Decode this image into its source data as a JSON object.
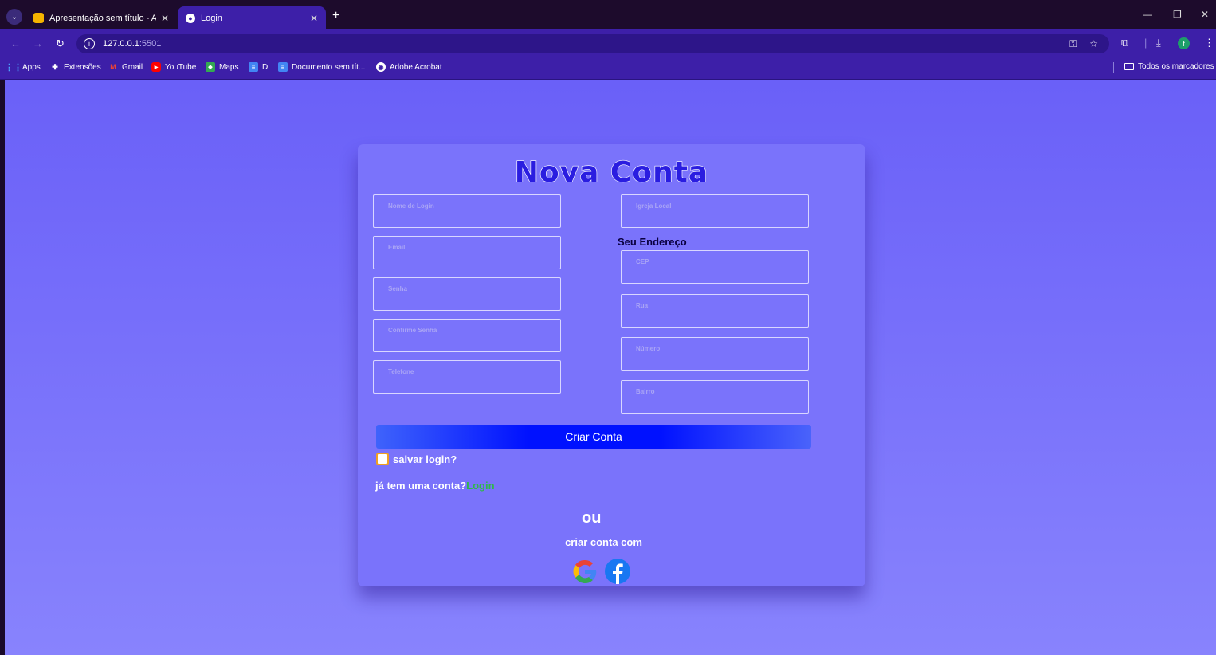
{
  "browser": {
    "tabs": [
      {
        "title": "Apresentação sem título - Apre",
        "icon": "slides-icon",
        "active": false
      },
      {
        "title": "Login",
        "icon": "user-icon",
        "active": true
      }
    ],
    "new_tab": "+",
    "url_host": "127.0.0.1",
    "url_port": ":5501",
    "profile_initial": "f",
    "bookmarks": [
      {
        "label": "Apps",
        "icon": "apps-grid-icon"
      },
      {
        "label": "Extensões",
        "icon": "puzzle-icon"
      },
      {
        "label": "Gmail",
        "icon": "gmail-icon"
      },
      {
        "label": "YouTube",
        "icon": "youtube-icon"
      },
      {
        "label": "Maps",
        "icon": "maps-icon"
      },
      {
        "label": "D",
        "icon": "docs-icon"
      },
      {
        "label": "Documento sem tít...",
        "icon": "docs-icon"
      },
      {
        "label": "Adobe Acrobat",
        "icon": "acrobat-icon"
      }
    ],
    "bookmarks_folder": "Todos os marcadores"
  },
  "form": {
    "title": "Nova Conta",
    "left_fields": [
      "Nome de Login",
      "Email",
      "Senha",
      "Confirme Senha",
      "Telefone"
    ],
    "church_field": "Igreja Local",
    "address_title": "Seu Endereço",
    "address_fields": [
      "CEP",
      "Rua",
      "Número",
      "Bairro"
    ],
    "submit": "Criar Conta",
    "remember": "salvar login?",
    "have_account": "já tem uma conta?",
    "login_link": "Login",
    "or": "ou",
    "create_with": "criar conta com"
  },
  "colors": {
    "page_bg_top": "#6a60f8",
    "card_bg": "#7a73fb",
    "title": "#2a1de0",
    "button": "#0011ff",
    "login_link": "#2fb84a"
  }
}
